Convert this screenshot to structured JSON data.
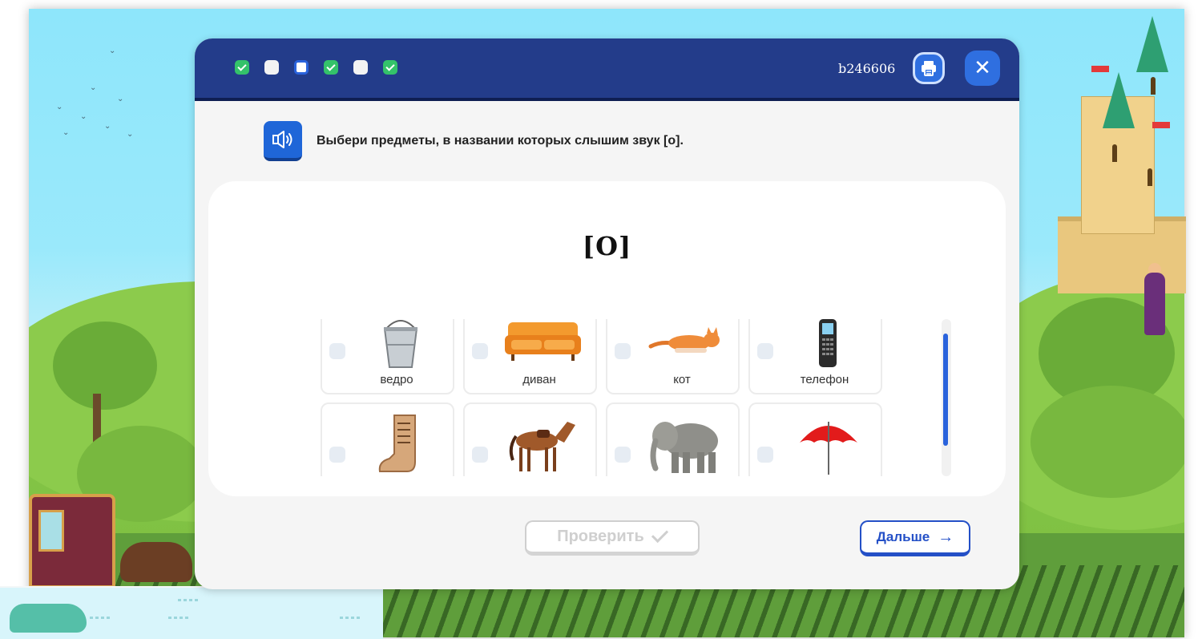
{
  "progress": [
    {
      "state": "checked"
    },
    {
      "state": "empty"
    },
    {
      "state": "current"
    },
    {
      "state": "checked"
    },
    {
      "state": "empty"
    },
    {
      "state": "checked"
    }
  ],
  "header": {
    "task_id": "b246606",
    "print_icon": "printer-icon",
    "close_icon": "close-icon",
    "close_glyph": "✕"
  },
  "instruction": {
    "sound_icon": "speaker-icon",
    "text": "Выбери предметы, в названии которых слышим звук [о]."
  },
  "exercise": {
    "sound": "[О]",
    "options": [
      {
        "label": "ведро",
        "icon": "bucket-icon"
      },
      {
        "label": "диван",
        "icon": "sofa-icon"
      },
      {
        "label": "кот",
        "icon": "cat-icon"
      },
      {
        "label": "телефон",
        "icon": "phone-icon"
      },
      {
        "label": "",
        "icon": "boot-icon"
      },
      {
        "label": "",
        "icon": "horse-icon"
      },
      {
        "label": "",
        "icon": "elephant-icon"
      },
      {
        "label": "",
        "icon": "umbrella-icon"
      }
    ]
  },
  "actions": {
    "check_label": "Проверить",
    "next_label": "Дальше",
    "next_arrow": "→"
  },
  "colors": {
    "header_bg": "#233c8a",
    "accent": "#2a63dc",
    "checked": "#34c26a"
  }
}
